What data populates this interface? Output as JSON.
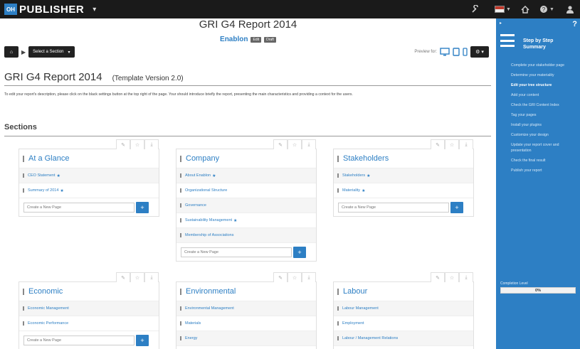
{
  "app": {
    "logo_text": "OH",
    "brand": "PUBLISHER",
    "brand_caret": "▾"
  },
  "topbar": {
    "icons": [
      "wrench-icon",
      "flag-icon",
      "home-icon",
      "help-icon",
      "user-icon"
    ]
  },
  "header": {
    "report_title": "GRI G4 Report 2014",
    "company": "Enablon",
    "badge_1": "Edit",
    "badge_2": "Draft"
  },
  "toolbar": {
    "home_label": "⌂",
    "section_select": "Select a Section",
    "select_caret": "▾",
    "preview_label": "Preview for:",
    "settings_label": "⚙ ▾"
  },
  "content": {
    "title": "GRI G4 Report 2014",
    "template_version": "(Template Version 2.0)",
    "description": "To edit your report's description, please click on the black settings button at the top right of the page. Your should introduce briefly the report, presenting the main characteristics and providing a context for the users.",
    "sections_heading": "Sections",
    "new_page_placeholder": "Create a New Page"
  },
  "sections": [
    {
      "title": "At a Glance",
      "pages": [
        {
          "label": "CEO Statement",
          "star": true
        },
        {
          "label": "Summary of 2014",
          "star": true
        }
      ]
    },
    {
      "title": "Company",
      "pages": [
        {
          "label": "About Enablon",
          "star": true
        },
        {
          "label": "Organizational Structure",
          "star": false
        },
        {
          "label": "Governance",
          "star": false
        },
        {
          "label": "Sustainability Management",
          "star": true
        },
        {
          "label": "Membership of Associations",
          "star": false
        }
      ]
    },
    {
      "title": "Stakeholders",
      "pages": [
        {
          "label": "Stakeholders",
          "star": true
        },
        {
          "label": "Materiality",
          "star": true
        }
      ]
    },
    {
      "title": "Economic",
      "pages": [
        {
          "label": "Economic Management",
          "star": false
        },
        {
          "label": "Economic Performance",
          "star": false
        }
      ]
    },
    {
      "title": "Environmental",
      "pages": [
        {
          "label": "Environmental Management",
          "star": false
        },
        {
          "label": "Materials",
          "star": false
        },
        {
          "label": "Energy",
          "star": false
        }
      ]
    },
    {
      "title": "Labour",
      "pages": [
        {
          "label": "Labour Management",
          "star": false
        },
        {
          "label": "Employment",
          "star": false
        },
        {
          "label": "Labour / Management Relations",
          "star": false
        }
      ]
    }
  ],
  "panel": {
    "collapse": "▸",
    "help": "?",
    "title": "Step by Step Summary",
    "steps": [
      "Complete your stakeholder page",
      "Determine your materiality",
      "Edit your tree structure",
      "Add your content",
      "Check the GRI Content Index",
      "Tag your pages",
      "Install your plugins",
      "Customize your design",
      "Update your report cover and presentation",
      "Check the final result",
      "Publish your report"
    ],
    "active_step": 2,
    "completion_label": "Completion Level",
    "completion_value": "0%",
    "completion_fraction": 0
  },
  "colors": {
    "accent": "#2d7fc4",
    "topbar": "#1a1a1a",
    "dark_button": "#222222"
  }
}
